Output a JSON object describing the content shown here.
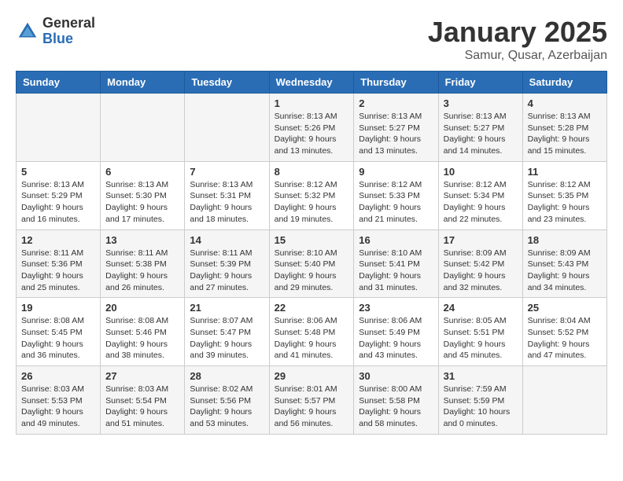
{
  "header": {
    "logo_general": "General",
    "logo_blue": "Blue",
    "month_title": "January 2025",
    "location": "Samur, Qusar, Azerbaijan"
  },
  "days_of_week": [
    "Sunday",
    "Monday",
    "Tuesday",
    "Wednesday",
    "Thursday",
    "Friday",
    "Saturday"
  ],
  "weeks": [
    [
      {
        "day": "",
        "info": ""
      },
      {
        "day": "",
        "info": ""
      },
      {
        "day": "",
        "info": ""
      },
      {
        "day": "1",
        "info": "Sunrise: 8:13 AM\nSunset: 5:26 PM\nDaylight: 9 hours\nand 13 minutes."
      },
      {
        "day": "2",
        "info": "Sunrise: 8:13 AM\nSunset: 5:27 PM\nDaylight: 9 hours\nand 13 minutes."
      },
      {
        "day": "3",
        "info": "Sunrise: 8:13 AM\nSunset: 5:27 PM\nDaylight: 9 hours\nand 14 minutes."
      },
      {
        "day": "4",
        "info": "Sunrise: 8:13 AM\nSunset: 5:28 PM\nDaylight: 9 hours\nand 15 minutes."
      }
    ],
    [
      {
        "day": "5",
        "info": "Sunrise: 8:13 AM\nSunset: 5:29 PM\nDaylight: 9 hours\nand 16 minutes."
      },
      {
        "day": "6",
        "info": "Sunrise: 8:13 AM\nSunset: 5:30 PM\nDaylight: 9 hours\nand 17 minutes."
      },
      {
        "day": "7",
        "info": "Sunrise: 8:13 AM\nSunset: 5:31 PM\nDaylight: 9 hours\nand 18 minutes."
      },
      {
        "day": "8",
        "info": "Sunrise: 8:12 AM\nSunset: 5:32 PM\nDaylight: 9 hours\nand 19 minutes."
      },
      {
        "day": "9",
        "info": "Sunrise: 8:12 AM\nSunset: 5:33 PM\nDaylight: 9 hours\nand 21 minutes."
      },
      {
        "day": "10",
        "info": "Sunrise: 8:12 AM\nSunset: 5:34 PM\nDaylight: 9 hours\nand 22 minutes."
      },
      {
        "day": "11",
        "info": "Sunrise: 8:12 AM\nSunset: 5:35 PM\nDaylight: 9 hours\nand 23 minutes."
      }
    ],
    [
      {
        "day": "12",
        "info": "Sunrise: 8:11 AM\nSunset: 5:36 PM\nDaylight: 9 hours\nand 25 minutes."
      },
      {
        "day": "13",
        "info": "Sunrise: 8:11 AM\nSunset: 5:38 PM\nDaylight: 9 hours\nand 26 minutes."
      },
      {
        "day": "14",
        "info": "Sunrise: 8:11 AM\nSunset: 5:39 PM\nDaylight: 9 hours\nand 27 minutes."
      },
      {
        "day": "15",
        "info": "Sunrise: 8:10 AM\nSunset: 5:40 PM\nDaylight: 9 hours\nand 29 minutes."
      },
      {
        "day": "16",
        "info": "Sunrise: 8:10 AM\nSunset: 5:41 PM\nDaylight: 9 hours\nand 31 minutes."
      },
      {
        "day": "17",
        "info": "Sunrise: 8:09 AM\nSunset: 5:42 PM\nDaylight: 9 hours\nand 32 minutes."
      },
      {
        "day": "18",
        "info": "Sunrise: 8:09 AM\nSunset: 5:43 PM\nDaylight: 9 hours\nand 34 minutes."
      }
    ],
    [
      {
        "day": "19",
        "info": "Sunrise: 8:08 AM\nSunset: 5:45 PM\nDaylight: 9 hours\nand 36 minutes."
      },
      {
        "day": "20",
        "info": "Sunrise: 8:08 AM\nSunset: 5:46 PM\nDaylight: 9 hours\nand 38 minutes."
      },
      {
        "day": "21",
        "info": "Sunrise: 8:07 AM\nSunset: 5:47 PM\nDaylight: 9 hours\nand 39 minutes."
      },
      {
        "day": "22",
        "info": "Sunrise: 8:06 AM\nSunset: 5:48 PM\nDaylight: 9 hours\nand 41 minutes."
      },
      {
        "day": "23",
        "info": "Sunrise: 8:06 AM\nSunset: 5:49 PM\nDaylight: 9 hours\nand 43 minutes."
      },
      {
        "day": "24",
        "info": "Sunrise: 8:05 AM\nSunset: 5:51 PM\nDaylight: 9 hours\nand 45 minutes."
      },
      {
        "day": "25",
        "info": "Sunrise: 8:04 AM\nSunset: 5:52 PM\nDaylight: 9 hours\nand 47 minutes."
      }
    ],
    [
      {
        "day": "26",
        "info": "Sunrise: 8:03 AM\nSunset: 5:53 PM\nDaylight: 9 hours\nand 49 minutes."
      },
      {
        "day": "27",
        "info": "Sunrise: 8:03 AM\nSunset: 5:54 PM\nDaylight: 9 hours\nand 51 minutes."
      },
      {
        "day": "28",
        "info": "Sunrise: 8:02 AM\nSunset: 5:56 PM\nDaylight: 9 hours\nand 53 minutes."
      },
      {
        "day": "29",
        "info": "Sunrise: 8:01 AM\nSunset: 5:57 PM\nDaylight: 9 hours\nand 56 minutes."
      },
      {
        "day": "30",
        "info": "Sunrise: 8:00 AM\nSunset: 5:58 PM\nDaylight: 9 hours\nand 58 minutes."
      },
      {
        "day": "31",
        "info": "Sunrise: 7:59 AM\nSunset: 5:59 PM\nDaylight: 10 hours\nand 0 minutes."
      },
      {
        "day": "",
        "info": ""
      }
    ]
  ]
}
